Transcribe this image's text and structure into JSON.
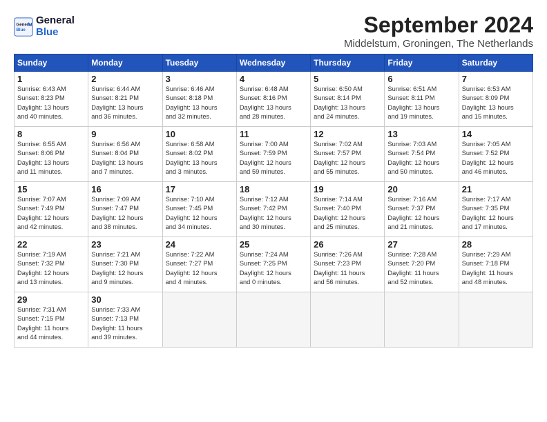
{
  "header": {
    "logo_line1": "General",
    "logo_line2": "Blue",
    "title": "September 2024",
    "location": "Middelstum, Groningen, The Netherlands"
  },
  "weekdays": [
    "Sunday",
    "Monday",
    "Tuesday",
    "Wednesday",
    "Thursday",
    "Friday",
    "Saturday"
  ],
  "weeks": [
    [
      {
        "day": "1",
        "sunrise": "6:43 AM",
        "sunset": "8:23 PM",
        "daylight": "13 hours and 40 minutes."
      },
      {
        "day": "2",
        "sunrise": "6:44 AM",
        "sunset": "8:21 PM",
        "daylight": "13 hours and 36 minutes."
      },
      {
        "day": "3",
        "sunrise": "6:46 AM",
        "sunset": "8:18 PM",
        "daylight": "13 hours and 32 minutes."
      },
      {
        "day": "4",
        "sunrise": "6:48 AM",
        "sunset": "8:16 PM",
        "daylight": "13 hours and 28 minutes."
      },
      {
        "day": "5",
        "sunrise": "6:50 AM",
        "sunset": "8:14 PM",
        "daylight": "13 hours and 24 minutes."
      },
      {
        "day": "6",
        "sunrise": "6:51 AM",
        "sunset": "8:11 PM",
        "daylight": "13 hours and 19 minutes."
      },
      {
        "day": "7",
        "sunrise": "6:53 AM",
        "sunset": "8:09 PM",
        "daylight": "13 hours and 15 minutes."
      }
    ],
    [
      {
        "day": "8",
        "sunrise": "6:55 AM",
        "sunset": "8:06 PM",
        "daylight": "13 hours and 11 minutes."
      },
      {
        "day": "9",
        "sunrise": "6:56 AM",
        "sunset": "8:04 PM",
        "daylight": "13 hours and 7 minutes."
      },
      {
        "day": "10",
        "sunrise": "6:58 AM",
        "sunset": "8:02 PM",
        "daylight": "13 hours and 3 minutes."
      },
      {
        "day": "11",
        "sunrise": "7:00 AM",
        "sunset": "7:59 PM",
        "daylight": "12 hours and 59 minutes."
      },
      {
        "day": "12",
        "sunrise": "7:02 AM",
        "sunset": "7:57 PM",
        "daylight": "12 hours and 55 minutes."
      },
      {
        "day": "13",
        "sunrise": "7:03 AM",
        "sunset": "7:54 PM",
        "daylight": "12 hours and 50 minutes."
      },
      {
        "day": "14",
        "sunrise": "7:05 AM",
        "sunset": "7:52 PM",
        "daylight": "12 hours and 46 minutes."
      }
    ],
    [
      {
        "day": "15",
        "sunrise": "7:07 AM",
        "sunset": "7:49 PM",
        "daylight": "12 hours and 42 minutes."
      },
      {
        "day": "16",
        "sunrise": "7:09 AM",
        "sunset": "7:47 PM",
        "daylight": "12 hours and 38 minutes."
      },
      {
        "day": "17",
        "sunrise": "7:10 AM",
        "sunset": "7:45 PM",
        "daylight": "12 hours and 34 minutes."
      },
      {
        "day": "18",
        "sunrise": "7:12 AM",
        "sunset": "7:42 PM",
        "daylight": "12 hours and 30 minutes."
      },
      {
        "day": "19",
        "sunrise": "7:14 AM",
        "sunset": "7:40 PM",
        "daylight": "12 hours and 25 minutes."
      },
      {
        "day": "20",
        "sunrise": "7:16 AM",
        "sunset": "7:37 PM",
        "daylight": "12 hours and 21 minutes."
      },
      {
        "day": "21",
        "sunrise": "7:17 AM",
        "sunset": "7:35 PM",
        "daylight": "12 hours and 17 minutes."
      }
    ],
    [
      {
        "day": "22",
        "sunrise": "7:19 AM",
        "sunset": "7:32 PM",
        "daylight": "12 hours and 13 minutes."
      },
      {
        "day": "23",
        "sunrise": "7:21 AM",
        "sunset": "7:30 PM",
        "daylight": "12 hours and 9 minutes."
      },
      {
        "day": "24",
        "sunrise": "7:22 AM",
        "sunset": "7:27 PM",
        "daylight": "12 hours and 4 minutes."
      },
      {
        "day": "25",
        "sunrise": "7:24 AM",
        "sunset": "7:25 PM",
        "daylight": "12 hours and 0 minutes."
      },
      {
        "day": "26",
        "sunrise": "7:26 AM",
        "sunset": "7:23 PM",
        "daylight": "11 hours and 56 minutes."
      },
      {
        "day": "27",
        "sunrise": "7:28 AM",
        "sunset": "7:20 PM",
        "daylight": "11 hours and 52 minutes."
      },
      {
        "day": "28",
        "sunrise": "7:29 AM",
        "sunset": "7:18 PM",
        "daylight": "11 hours and 48 minutes."
      }
    ],
    [
      {
        "day": "29",
        "sunrise": "7:31 AM",
        "sunset": "7:15 PM",
        "daylight": "11 hours and 44 minutes."
      },
      {
        "day": "30",
        "sunrise": "7:33 AM",
        "sunset": "7:13 PM",
        "daylight": "11 hours and 39 minutes."
      },
      null,
      null,
      null,
      null,
      null
    ]
  ]
}
